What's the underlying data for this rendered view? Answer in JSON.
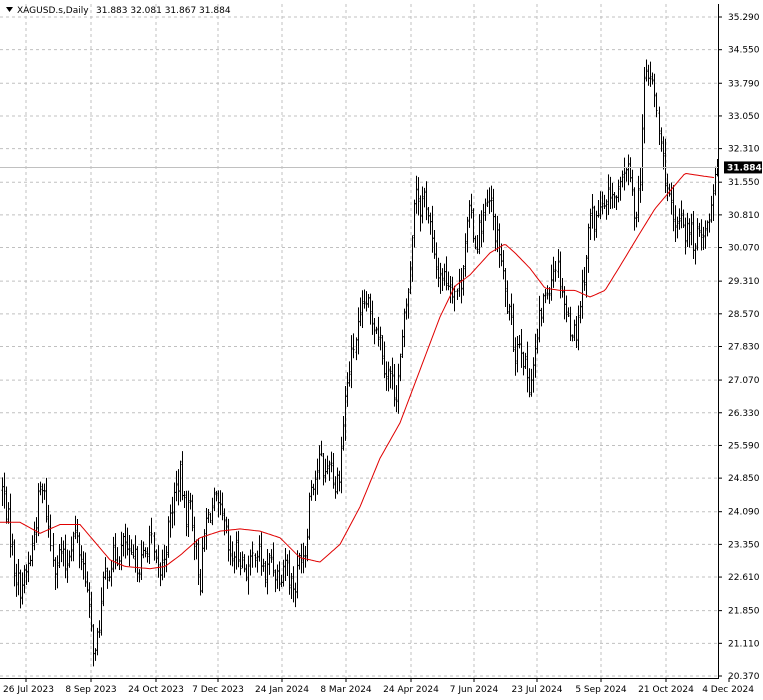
{
  "header": {
    "symbol": "XAGUSD.s,Daily",
    "ohlc": "31.883 32.081 31.867 31.884"
  },
  "chart_data": {
    "type": "bar",
    "subtype": "ohlc",
    "symbol": "XAGUSD.s",
    "timeframe": "Daily",
    "current_price": 31.884,
    "current_price_label": "31.884",
    "ylim": [
      20.37,
      35.29
    ],
    "y_ticks": [
      "35.290",
      "34.550",
      "33.790",
      "33.050",
      "32.310",
      "31.550",
      "30.810",
      "30.070",
      "29.310",
      "28.570",
      "27.830",
      "27.070",
      "26.330",
      "25.590",
      "24.850",
      "24.090",
      "23.350",
      "22.610",
      "21.850",
      "21.110",
      "20.370"
    ],
    "x_ticks": [
      "26 Jul 2023",
      "8 Sep 2023",
      "24 Oct 2023",
      "7 Dec 2023",
      "24 Jan 2024",
      "8 Mar 2024",
      "24 Apr 2024",
      "7 Jun 2024",
      "23 Jul 2024",
      "5 Sep 2024",
      "21 Oct 2024",
      "4 Dec 2024"
    ],
    "grid": true,
    "colors": {
      "bars": "#000000",
      "moving_average": "#e00000",
      "grid": "#c0c0c0",
      "price_line": "#c0c0c0",
      "price_tag_bg": "#000000"
    },
    "bar_count": 355,
    "close_anchors": [
      [
        0,
        24.8
      ],
      [
        5,
        24.3
      ],
      [
        10,
        23.6
      ],
      [
        15,
        22.7
      ],
      [
        20,
        22.4
      ],
      [
        25,
        22.6
      ],
      [
        30,
        23.0
      ],
      [
        35,
        23.7
      ],
      [
        40,
        24.6
      ],
      [
        45,
        24.4
      ],
      [
        50,
        23.4
      ],
      [
        55,
        22.9
      ],
      [
        60,
        23.2
      ],
      [
        65,
        22.8
      ],
      [
        70,
        23.4
      ],
      [
        75,
        23.6
      ],
      [
        80,
        23.1
      ],
      [
        85,
        22.7
      ],
      [
        90,
        21.5
      ],
      [
        95,
        20.8
      ],
      [
        100,
        21.8
      ],
      [
        105,
        22.7
      ],
      [
        110,
        22.9
      ],
      [
        115,
        23.1
      ],
      [
        120,
        23.2
      ],
      [
        125,
        23.4
      ],
      [
        130,
        22.9
      ],
      [
        135,
        23.0
      ],
      [
        140,
        22.9
      ],
      [
        145,
        23.1
      ],
      [
        150,
        23.6
      ],
      [
        155,
        22.8
      ],
      [
        160,
        22.7
      ],
      [
        165,
        23.3
      ],
      [
        170,
        24.0
      ],
      [
        175,
        24.6
      ],
      [
        180,
        24.9
      ],
      [
        185,
        24.0
      ],
      [
        190,
        24.3
      ],
      [
        195,
        23.3
      ],
      [
        200,
        22.5
      ],
      [
        205,
        23.8
      ],
      [
        210,
        24.1
      ],
      [
        215,
        24.3
      ],
      [
        220,
        24.0
      ],
      [
        225,
        23.7
      ],
      [
        230,
        22.9
      ],
      [
        235,
        23.2
      ],
      [
        240,
        23.1
      ],
      [
        245,
        22.8
      ],
      [
        250,
        22.8
      ],
      [
        255,
        23.3
      ],
      [
        260,
        23.0
      ],
      [
        265,
        22.6
      ],
      [
        270,
        23.1
      ],
      [
        275,
        22.7
      ],
      [
        280,
        22.7
      ],
      [
        285,
        23.1
      ],
      [
        290,
        22.5
      ],
      [
        295,
        22.4
      ],
      [
        300,
        23.2
      ],
      [
        305,
        23.2
      ],
      [
        310,
        24.7
      ],
      [
        315,
        24.9
      ],
      [
        320,
        25.3
      ],
      [
        325,
        24.9
      ],
      [
        330,
        25.4
      ],
      [
        335,
        24.6
      ],
      [
        340,
        25.1
      ],
      [
        345,
        26.6
      ],
      [
        350,
        27.4
      ],
      [
        355,
        28.0
      ],
      [
        360,
        28.4
      ],
      [
        365,
        28.9
      ],
      [
        370,
        28.5
      ],
      [
        375,
        28.4
      ],
      [
        380,
        28.0
      ],
      [
        385,
        27.3
      ],
      [
        390,
        27.2
      ],
      [
        395,
        26.7
      ],
      [
        400,
        27.5
      ],
      [
        405,
        28.6
      ],
      [
        410,
        29.5
      ],
      [
        415,
        31.6
      ],
      [
        420,
        31.0
      ],
      [
        425,
        31.3
      ],
      [
        430,
        30.6
      ],
      [
        435,
        29.6
      ],
      [
        440,
        29.5
      ],
      [
        445,
        29.4
      ],
      [
        450,
        29.3
      ],
      [
        455,
        29.1
      ],
      [
        460,
        29.2
      ],
      [
        465,
        30.4
      ],
      [
        470,
        30.9
      ],
      [
        475,
        30.1
      ],
      [
        480,
        30.6
      ],
      [
        485,
        30.9
      ],
      [
        490,
        31.1
      ],
      [
        495,
        30.4
      ],
      [
        500,
        29.9
      ],
      [
        505,
        29.0
      ],
      [
        510,
        28.4
      ],
      [
        515,
        27.7
      ],
      [
        520,
        28.1
      ],
      [
        525,
        27.3
      ],
      [
        530,
        27.0
      ],
      [
        535,
        27.6
      ],
      [
        540,
        28.5
      ],
      [
        545,
        29.0
      ],
      [
        550,
        29.3
      ],
      [
        555,
        29.8
      ],
      [
        560,
        29.4
      ],
      [
        565,
        28.6
      ],
      [
        570,
        28.3
      ],
      [
        575,
        28.1
      ],
      [
        580,
        28.9
      ],
      [
        585,
        29.7
      ],
      [
        590,
        30.9
      ],
      [
        595,
        30.6
      ],
      [
        600,
        31.0
      ],
      [
        605,
        30.8
      ],
      [
        610,
        31.4
      ],
      [
        615,
        31.1
      ],
      [
        620,
        31.3
      ],
      [
        625,
        32.0
      ],
      [
        630,
        31.6
      ],
      [
        635,
        30.8
      ],
      [
        640,
        31.6
      ],
      [
        645,
        34.0
      ],
      [
        650,
        34.0
      ],
      [
        655,
        33.4
      ],
      [
        660,
        32.4
      ],
      [
        665,
        31.7
      ],
      [
        670,
        30.9
      ],
      [
        675,
        30.3
      ],
      [
        680,
        31.0
      ],
      [
        685,
        30.4
      ],
      [
        690,
        30.5
      ],
      [
        695,
        30.0
      ],
      [
        700,
        30.6
      ],
      [
        705,
        30.4
      ],
      [
        710,
        30.9
      ],
      [
        715,
        31.88
      ]
    ],
    "ma_anchors": [
      [
        0,
        23.85
      ],
      [
        20,
        23.85
      ],
      [
        40,
        23.6
      ],
      [
        60,
        23.8
      ],
      [
        80,
        23.8
      ],
      [
        95,
        23.4
      ],
      [
        110,
        23.0
      ],
      [
        125,
        22.85
      ],
      [
        150,
        22.8
      ],
      [
        165,
        22.85
      ],
      [
        180,
        23.1
      ],
      [
        200,
        23.5
      ],
      [
        220,
        23.65
      ],
      [
        240,
        23.7
      ],
      [
        260,
        23.65
      ],
      [
        280,
        23.5
      ],
      [
        300,
        23.05
      ],
      [
        320,
        22.95
      ],
      [
        340,
        23.35
      ],
      [
        360,
        24.2
      ],
      [
        380,
        25.3
      ],
      [
        400,
        26.1
      ],
      [
        420,
        27.3
      ],
      [
        440,
        28.5
      ],
      [
        455,
        29.2
      ],
      [
        470,
        29.45
      ],
      [
        490,
        29.95
      ],
      [
        505,
        30.15
      ],
      [
        515,
        29.95
      ],
      [
        530,
        29.6
      ],
      [
        545,
        29.15
      ],
      [
        560,
        29.1
      ],
      [
        575,
        29.1
      ],
      [
        590,
        28.95
      ],
      [
        605,
        29.1
      ],
      [
        620,
        29.65
      ],
      [
        640,
        30.4
      ],
      [
        655,
        30.95
      ],
      [
        670,
        31.35
      ],
      [
        685,
        31.75
      ],
      [
        700,
        31.7
      ],
      [
        715,
        31.65
      ]
    ]
  }
}
